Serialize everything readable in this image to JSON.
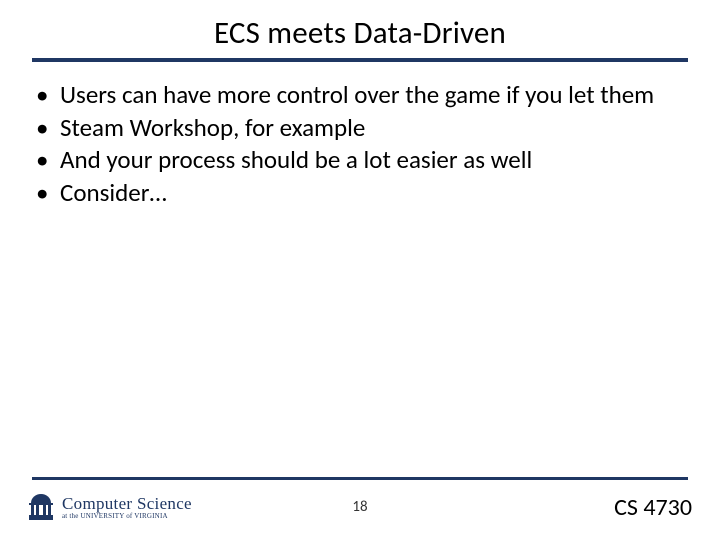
{
  "title": "ECS meets Data-Driven",
  "bullets": [
    "Users can have more control over the game if you let them",
    "Steam Workshop, for example",
    "And your process should be a lot easier as well",
    "Consider…"
  ],
  "footer": {
    "logo_main": "Computer Science",
    "logo_sub": "at the UNIVERSITY of VIRGINIA",
    "page_number": "18",
    "course_code": "CS 4730"
  },
  "colors": {
    "rule": "#1f3763"
  }
}
